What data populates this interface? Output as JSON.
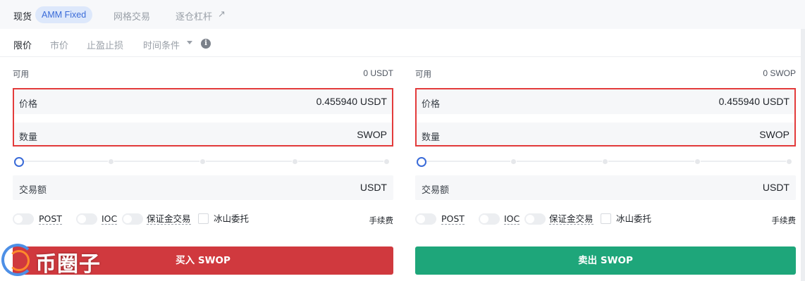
{
  "top_tabs": {
    "spot": "现货",
    "amm_badge": "AMM Fixed",
    "grid": "网格交易",
    "margin": "逐仓杠杆",
    "margin_arrow": "↗"
  },
  "order_tabs": {
    "limit": "限价",
    "market": "市价",
    "tpsl": "止盈止损",
    "time_cond": "时间条件",
    "info_icon": "i"
  },
  "buy": {
    "avail_label": "可用",
    "avail_value": "0 USDT",
    "price_label": "价格",
    "price_value": "0.455940 USDT",
    "amount_label": "数量",
    "amount_unit": "SWOP",
    "total_label": "交易额",
    "total_unit": "USDT",
    "opt_post": "POST",
    "opt_ioc": "IOC",
    "opt_margin": "保证金交易",
    "opt_iceberg": "冰山委托",
    "fee": "手续费",
    "button": "买入 SWOP"
  },
  "sell": {
    "avail_label": "可用",
    "avail_value": "0 SWOP",
    "price_label": "价格",
    "price_value": "0.455940 USDT",
    "amount_label": "数量",
    "amount_unit": "SWOP",
    "total_label": "交易额",
    "total_unit": "USDT",
    "opt_post": "POST",
    "opt_ioc": "IOC",
    "opt_margin": "保证金交易",
    "opt_iceberg": "冰山委托",
    "fee": "手续费",
    "button": "卖出 SWOP"
  },
  "watermark": "币圈子",
  "colors": {
    "accent": "#3a6bd8",
    "buy": "#d0393e",
    "sell": "#1ea67a",
    "highlight": "#e33b3b"
  }
}
